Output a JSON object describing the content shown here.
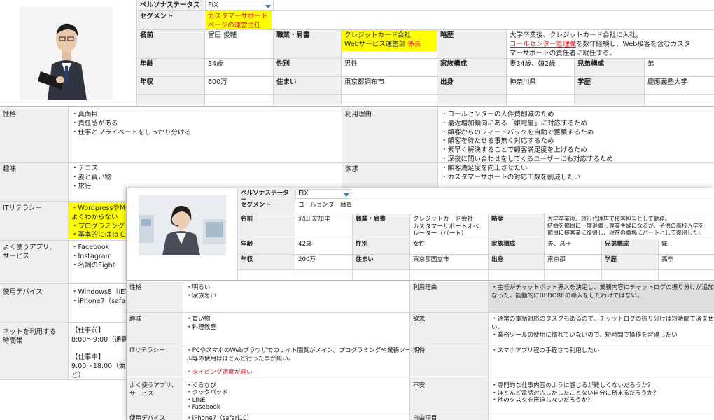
{
  "p1": {
    "persona_status_label": "ペルソナステータス",
    "persona_status_value": "FIX",
    "segment_label": "セグメント",
    "segment_value": "カスタマーサポートページの運営主任",
    "name_label": "名前",
    "name_value": "宮田 俊輔",
    "job_label": "職業・肩書",
    "job_line1": "クレジットカード会社",
    "job_line2a": "Webサービス運営部 ",
    "job_line2b": "係長",
    "career_label": "略歴",
    "career_line1": "大学卒業後、クレジットカード会社に入社。",
    "career_line2a": "コールセンター管理職",
    "career_line2b": "を数年経験し、Web接客を含むカスタ",
    "career_line3": "マーサポートの責任者に就任する。",
    "age_label": "年齢",
    "age_value": "34歳",
    "gender_label": "性別",
    "gender_value": "男性",
    "family_label": "家族構成",
    "family_value": "妻34歳、娘2歳",
    "siblings_label": "兄弟構成",
    "siblings_value": "弟",
    "income_label": "年収",
    "income_value": "600万",
    "home_label": "住まい",
    "home_value": "東京都調布市",
    "origin_label": "出身",
    "origin_value": "神奈川県",
    "edu_label": "学歴",
    "edu_value": "慶應義塾大学",
    "personality_label": "性格",
    "personality": [
      "・真面目",
      "・責任感がある",
      "・仕事とプライベートをしっかり分ける"
    ],
    "reason_label": "利用理由",
    "reasons": [
      "・コールセンターの人件費削減のため",
      "・最近増加傾向にある「嫌電層」に対応するため",
      "・顧客からのフィードバックを自動で蓄積するため",
      "・顧客を待たせる事無く対応するため",
      "・素早く解決することで顧客満足度を上げるため",
      "・深夜に問い合わせをしてくるユーザーにも対応するため"
    ],
    "hobby_label": "趣味",
    "hobbies": [
      "・テニス",
      "・妻と買い物",
      "・旅行"
    ],
    "desire_label": "欲求",
    "desires": [
      "・顧客満足度を向上させたい",
      "・カスタマーサポートの対応工数を削減したい"
    ],
    "it_label": "ITリテラシー",
    "it_lines": [
      "・WordpressやMe",
      "よくわからない",
      "・プログラミング",
      "・基本的にはTo C"
    ],
    "apps_label1": "よく使うアプリ、",
    "apps_label2": "サービス",
    "apps": [
      "・Facebook",
      "・Instagram",
      "・名詞のEight"
    ],
    "device_label": "使用デバイス",
    "devices": [
      "・Windows8（IEで",
      "・iPhone7（safari"
    ],
    "net_label1": "ネットを利用する",
    "net_label2": "時間帯",
    "net_lines": [
      "【仕事前】",
      "8:00～9:00（通勤",
      "",
      "【仕事中】",
      "9:00～18:00（競合",
      "ど）"
    ]
  },
  "p2": {
    "persona_status_label": "ペルソナステータス",
    "persona_status_value": "FIX",
    "segment_label": "セグメント",
    "segment_value": "コールセンター職員",
    "name_label": "名前",
    "name_value": "沢田 友加里",
    "job_label": "職業・肩書",
    "job_lines": [
      "クレジットカード会社",
      "カスタマーサポートオペ",
      "レーター（パート）"
    ],
    "career_label": "略歴",
    "career_lines": [
      "大学卒業後、旅行代理店で接客担当として勤務。",
      "結婚を節目に一度退職し専業主婦になるが、子供の高校入学を",
      "節目に接客業に復帰し、現在の職場にパートとして復帰した。"
    ],
    "age_label": "年齢",
    "age_value": "42歳",
    "gender_label": "性別",
    "gender_value": "女性",
    "family_label": "家族構成",
    "family_value": "夫、息子",
    "siblings_label": "兄弟構成",
    "siblings_value": "妹",
    "income_label": "年収",
    "income_value": "200万",
    "home_label": "住まい",
    "home_value": "東京都国立市",
    "origin_label": "出身",
    "origin_value": "東京都",
    "edu_label": "学歴",
    "edu_value": "高卒",
    "personality_label": "性格",
    "personality": [
      "・明るい",
      "・家族思い"
    ],
    "reason_label": "利用理由",
    "reasons": [
      "・主任がチャットボット導入を決定し、業務内容にチャットログの振り分けが追加に",
      "なった。能動的にBEDOREの導入をしたわけではない。"
    ],
    "hobby_label": "趣味",
    "hobbies": [
      "・買い物",
      "・料理教室"
    ],
    "desire_label": "欲求",
    "desires": [
      "・通常の電話対応のタスクもあるので、チャットログの振り分けは短時間で済ませた",
      "い。",
      "・業務ツールの使用に慣れていないので、短時間で操作を習得したい"
    ],
    "it_label": "ITリテラシー",
    "it_lines": [
      "・PCやスマホのWebブラウザでのサイト閲覧がメイン。プログラミングや業務ツー",
      "ル等の使用はほとんど行った事が無い。"
    ],
    "it_red": "・タイピング速度が遅い",
    "expect_label": "期待",
    "expects": [
      "・スマホアプリ程の手軽さで利用したい"
    ],
    "apps_label1": "よく使うアプリ、",
    "apps_label2": "サービス",
    "apps": [
      "・ぐるなび",
      "・クックパッド",
      "・LINE",
      "・Fasebook"
    ],
    "anxiety_label": "不安",
    "anxieties": [
      "・専門的な仕事内容のように感じるが難しくないだろうか？",
      "・ほとんど電話対応しかしたことない自分に務まるだろうか？",
      "・他のタスクを圧迫しないだろうか？"
    ],
    "device_label": "使用デバイス",
    "device_value": "・iPhone7（safari10）",
    "free_label": "自由項目"
  }
}
